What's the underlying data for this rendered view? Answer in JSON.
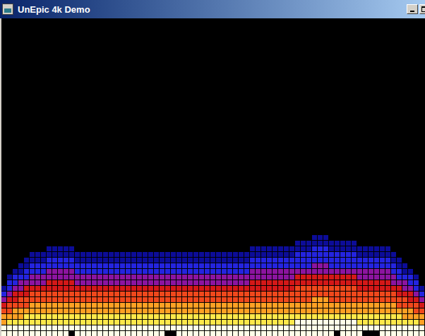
{
  "window": {
    "title": "UnEpic 4k Demo"
  },
  "fire": {
    "columns": [
      9,
      11,
      12,
      13,
      14,
      15,
      15,
      15,
      16,
      16,
      16,
      16,
      16,
      15,
      15,
      15,
      15,
      15,
      15,
      15,
      15,
      15,
      15,
      15,
      15,
      15,
      15,
      15,
      15,
      15,
      15,
      15,
      15,
      15,
      15,
      15,
      15,
      15,
      15,
      15,
      15,
      15,
      15,
      15,
      16,
      16,
      16,
      16,
      16,
      16,
      16,
      16,
      17,
      17,
      17,
      18,
      18,
      18,
      17,
      17,
      17,
      17,
      17,
      16,
      16,
      16,
      16,
      16,
      16,
      15,
      14,
      13,
      12,
      11,
      9
    ],
    "bottom_gaps": [
      12,
      29,
      30,
      59,
      64,
      65,
      66
    ]
  }
}
